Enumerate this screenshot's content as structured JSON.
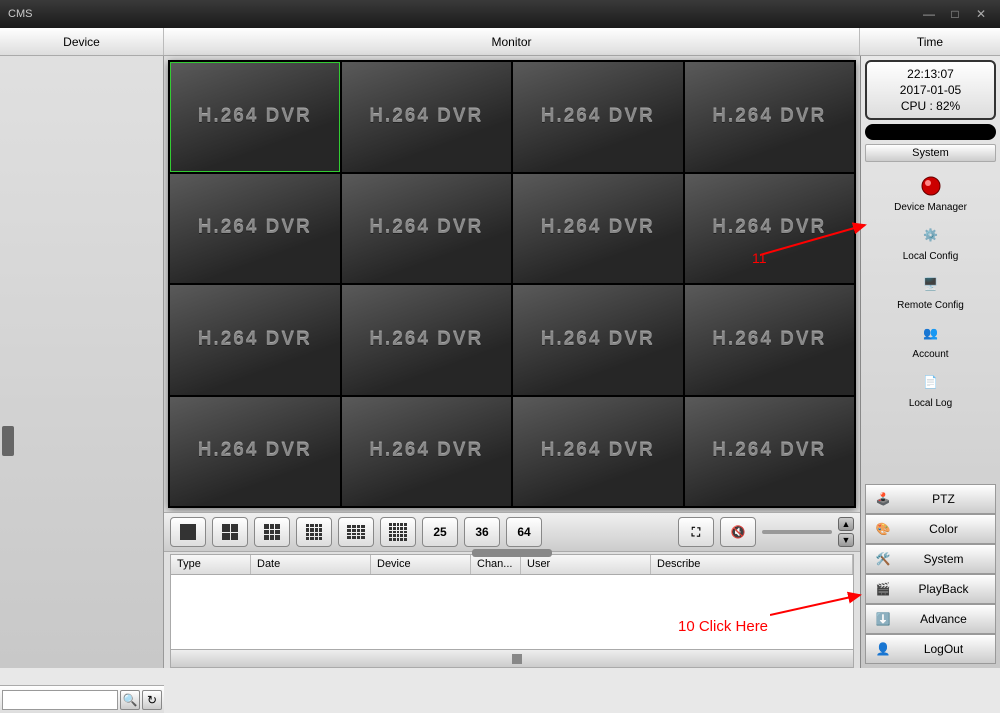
{
  "app_title": "CMS",
  "nav": {
    "device": "Device",
    "monitor": "Monitor",
    "time": "Time"
  },
  "clock": {
    "time": "22:13:07",
    "date": "2017-01-05",
    "cpu": "CPU : 82%"
  },
  "system_panel": {
    "title": "System",
    "items": [
      {
        "label": "Device Manager"
      },
      {
        "label": "Local Config"
      },
      {
        "label": "Remote Config"
      },
      {
        "label": "Account"
      },
      {
        "label": "Local Log"
      }
    ]
  },
  "rtabs": [
    {
      "label": "PTZ"
    },
    {
      "label": "Color"
    },
    {
      "label": "System"
    },
    {
      "label": "PlayBack"
    },
    {
      "label": "Advance"
    },
    {
      "label": "LogOut"
    }
  ],
  "grid": {
    "cell_label": "H.264 DVR",
    "layout_numbers": {
      "b25": "25",
      "b36": "36",
      "b64": "64"
    }
  },
  "log_columns": {
    "type": "Type",
    "date": "Date",
    "device": "Device",
    "channel": "Chan...",
    "user": "User",
    "describe": "Describe"
  },
  "annotations": {
    "n11": "11",
    "n10": "10  Click Here"
  }
}
